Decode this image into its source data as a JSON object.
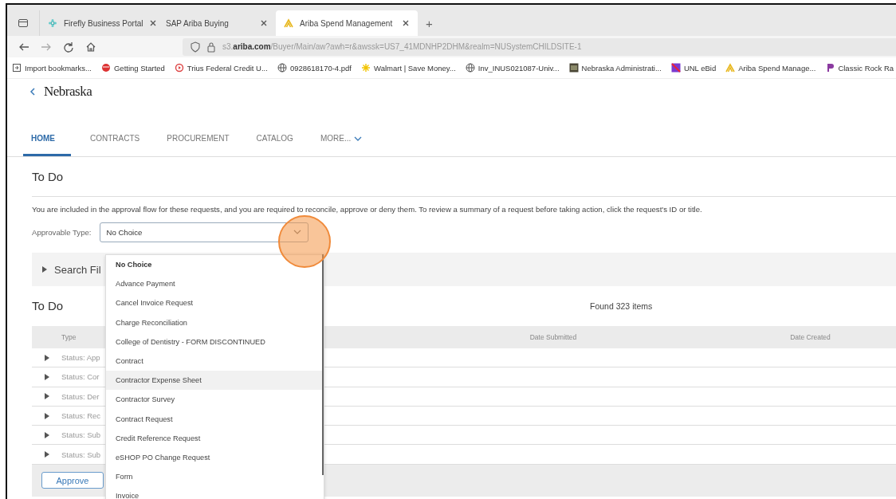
{
  "browser": {
    "tabs": [
      {
        "title": "Firefly Business Portal",
        "selected": false
      },
      {
        "title": "SAP Ariba Buying",
        "selected": false
      },
      {
        "title": "Ariba Spend Management",
        "selected": true
      }
    ],
    "new_tab": "+",
    "url": "s3.**ariba.com**/Buyer/Main/aw?awh=r&awssk=US7_41MDNHP2DHM&realm=NUSystemCHILDSITE-1",
    "bookmarks": [
      {
        "label": "Import bookmarks..."
      },
      {
        "label": "Getting Started"
      },
      {
        "label": "Trius Federal Credit U..."
      },
      {
        "label": "0928618170-4.pdf"
      },
      {
        "label": "Walmart | Save Money..."
      },
      {
        "label": "Inv_INUS021087-Univ..."
      },
      {
        "label": "Nebraska Administrati..."
      },
      {
        "label": "UNL eBid"
      },
      {
        "label": "Ariba Spend Manage..."
      },
      {
        "label": "Classic Rock Ra"
      }
    ]
  },
  "site": {
    "logo": "Nebraska"
  },
  "nav": [
    {
      "label": "HOME",
      "selected": true
    },
    {
      "label": "CONTRACTS",
      "selected": false
    },
    {
      "label": "PROCUREMENT",
      "selected": false
    },
    {
      "label": "CATALOG",
      "selected": false
    },
    {
      "label": "MORE...",
      "selected": false,
      "menu": true
    }
  ],
  "todo": {
    "title": "To Do",
    "description": "You are included in the approval flow for these requests, and you are required to reconcile, approve or deny them. To review a summary of a request before taking action, click the request's ID or title.",
    "approvable_type": {
      "label": "Approvable Type:",
      "value": "No Choice",
      "options": [
        {
          "label": "No Choice",
          "selected": true,
          "highlighted": false
        },
        {
          "label": "Advance Payment",
          "selected": false,
          "highlighted": false
        },
        {
          "label": "Cancel Invoice Request",
          "selected": false,
          "highlighted": false
        },
        {
          "label": "Charge Reconciliation",
          "selected": false,
          "highlighted": false
        },
        {
          "label": "College of Dentistry - FORM DISCONTINUED",
          "selected": false,
          "highlighted": false
        },
        {
          "label": "Contract",
          "selected": false,
          "highlighted": false
        },
        {
          "label": "Contractor Expense Sheet",
          "selected": false,
          "highlighted": true
        },
        {
          "label": "Contractor Survey",
          "selected": false,
          "highlighted": false
        },
        {
          "label": "Contract Request",
          "selected": false,
          "highlighted": false
        },
        {
          "label": "Credit Reference Request",
          "selected": false,
          "highlighted": false
        },
        {
          "label": "eSHOP PO Change Request",
          "selected": false,
          "highlighted": false
        },
        {
          "label": "Form",
          "selected": false,
          "highlighted": false
        },
        {
          "label": "Invoice",
          "selected": false,
          "highlighted": false
        }
      ]
    },
    "search_filters": "Search Fil"
  },
  "list": {
    "title": "To Do",
    "count": "Found 323 items",
    "columns": [
      "Type",
      "Date Submitted",
      "Date Created"
    ],
    "rows": [
      {
        "type": "Status: App"
      },
      {
        "type": "Status: Cor"
      },
      {
        "type": "Status: Der"
      },
      {
        "type": "Status: Rec"
      },
      {
        "type": "Status: Sub"
      },
      {
        "type": "Status: Sub"
      }
    ],
    "buttons": [
      "Approve"
    ]
  }
}
